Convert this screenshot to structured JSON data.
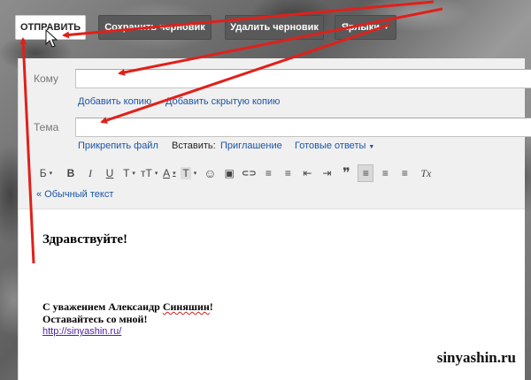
{
  "toolbar": {
    "send_label": "ОТПРАВИТЬ",
    "save_draft_label": "Сохранить черновик",
    "delete_draft_label": "Удалить черновик",
    "labels_label": "Ярлыки"
  },
  "compose": {
    "to_label": "Кому",
    "to_value": "",
    "add_cc_label": "Добавить копию",
    "add_bcc_label": "Добавить скрытую копию",
    "subject_label": "Тема",
    "subject_value": "",
    "attach_file_label": "Прикрепить файл",
    "insert_label": "Вставить:",
    "invitation_label": "Приглашение",
    "canned_responses_label": "Готовые ответы",
    "plain_text_label": "« Обычный текст"
  },
  "formatting": {
    "font_label": "Б",
    "bold": "B",
    "italic": "I",
    "underline": "U",
    "font_size_glyph": "T",
    "size_glyph": "тT",
    "text_color_glyph": "A",
    "highlight_glyph": "T",
    "emoji_icon": "☺",
    "image_icon": "▣",
    "link_icon": "⊂⊃",
    "numbered_list_icon": "≡",
    "bulleted_list_icon": "≡",
    "indent_less_icon": "⇤",
    "indent_more_icon": "⇥",
    "quote_icon": "❞",
    "align_left_icon": "≡",
    "align_center_icon": "≡",
    "align_right_icon": "≡",
    "clear_format_icon": "Tx"
  },
  "body": {
    "greeting": "Здравствуйте!",
    "signature_prefix": "С уважением Александр ",
    "signature_name": "Синяшин",
    "signature_suffix": "!",
    "signature_line2": "Оставайтесь со мной!",
    "url": "http://sinyashin.ru/"
  },
  "watermark": "sinyashin.ru",
  "annotation_color": "#e0201b"
}
